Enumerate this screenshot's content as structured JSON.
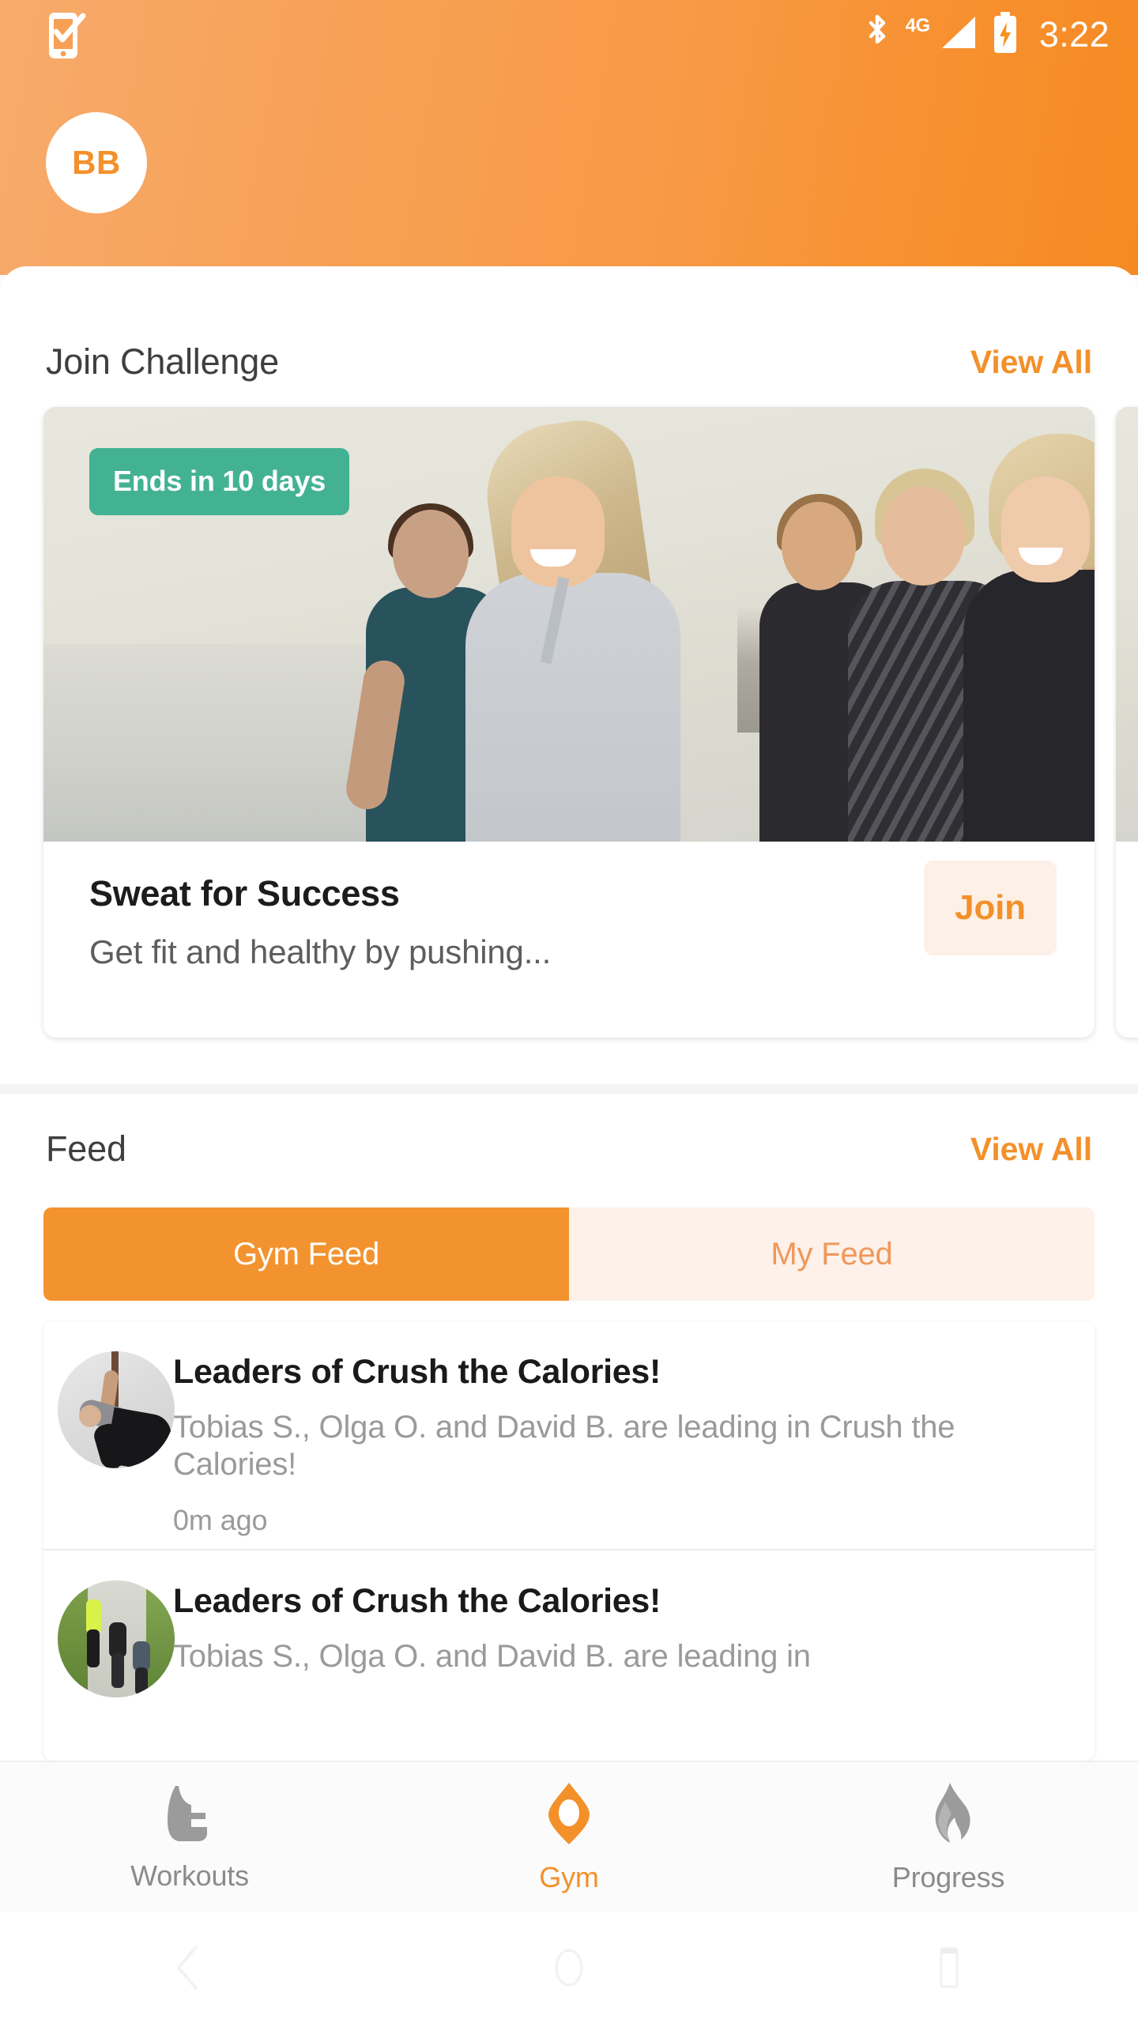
{
  "status_bar": {
    "left_icon": "phone-check-icon",
    "bluetooth_icon": "bluetooth-icon",
    "network_label": "4G",
    "signal_icon": "signal-bars-icon",
    "battery_icon": "battery-charging-icon",
    "time": "3:22"
  },
  "header": {
    "avatar_initials": "BB",
    "gradient_from": "#f7ab6b",
    "gradient_to": "#f68a22"
  },
  "challenge_section": {
    "title": "Join Challenge",
    "view_all_label": "View All",
    "cards": [
      {
        "badge": "Ends in 10 days",
        "name": "Sweat for Success",
        "description": "Get fit and healthy by pushing...",
        "join_label": "Join",
        "image_alt": "group-of-runners-by-the-water"
      }
    ]
  },
  "feed_section": {
    "title": "Feed",
    "view_all_label": "View All",
    "tabs": [
      {
        "label": "Gym Feed",
        "active": true
      },
      {
        "label": "My Feed",
        "active": false
      }
    ],
    "items": [
      {
        "title": "Leaders of Crush the Calories!",
        "body": "Tobias S., Olga O. and David B. are leading in Crush the Calories!",
        "time": "0m ago",
        "avatar_alt": "yoga-stretch-photo"
      },
      {
        "title": "Leaders of Crush the Calories!",
        "body": "Tobias S., Olga O. and David B. are leading in",
        "time": "",
        "avatar_alt": "runners-on-path-photo"
      }
    ]
  },
  "bottom_nav": {
    "items": [
      {
        "label": "Workouts",
        "icon": "shoe-icon",
        "active": false
      },
      {
        "label": "Gym",
        "icon": "location-pin-icon",
        "active": true
      },
      {
        "label": "Progress",
        "icon": "flame-icon",
        "active": false
      }
    ],
    "active_color": "#f3902a",
    "inactive_color": "#8b8b8b"
  },
  "system_nav": {
    "back_icon": "back-chevron-icon",
    "home_icon": "home-circle-icon",
    "recents_icon": "recents-square-icon"
  }
}
